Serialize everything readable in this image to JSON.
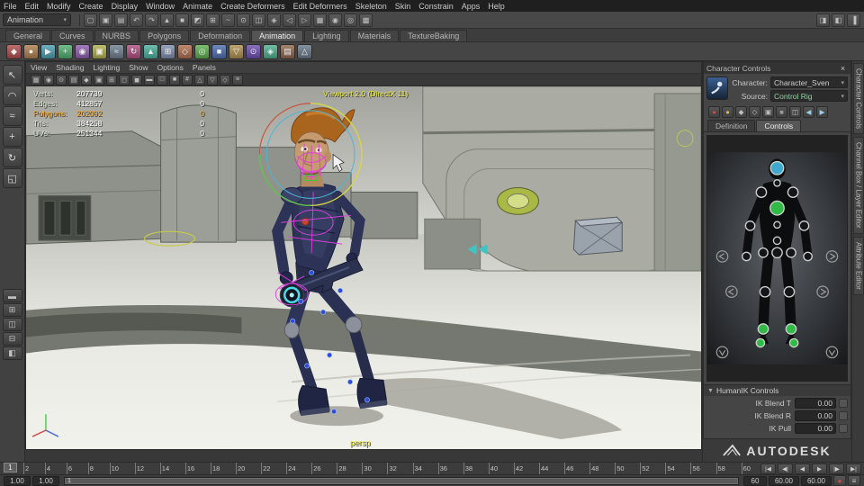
{
  "ui": {
    "caret_down": "▾",
    "tri_down": "▼",
    "close": "×"
  },
  "menubar": {
    "items": [
      "File",
      "Edit",
      "Modify",
      "Create",
      "Display",
      "Window",
      "Animate",
      "Create Deformers",
      "Edit Deformers",
      "Skeleton",
      "Skin",
      "Constrain",
      "Apps",
      "Help"
    ]
  },
  "statusline": {
    "menu_set": "Animation",
    "icons": [
      {
        "name": "new-scene-icon",
        "glyph": "▢"
      },
      {
        "name": "open-scene-icon",
        "glyph": "▣"
      },
      {
        "name": "save-scene-icon",
        "glyph": "▤"
      },
      {
        "name": "undo-icon",
        "glyph": "↶"
      },
      {
        "name": "redo-icon",
        "glyph": "↷"
      },
      {
        "name": "select-hierarchy-icon",
        "glyph": "▲"
      },
      {
        "name": "select-object-icon",
        "glyph": "■"
      },
      {
        "name": "select-component-icon",
        "glyph": "◩"
      },
      {
        "name": "snap-to-grid-icon",
        "glyph": "⊞"
      },
      {
        "name": "snap-to-curve-icon",
        "glyph": "~"
      },
      {
        "name": "snap-to-point-icon",
        "glyph": "⊙"
      },
      {
        "name": "snap-to-plane-icon",
        "glyph": "◫"
      },
      {
        "name": "make-live-icon",
        "glyph": "◈"
      },
      {
        "name": "input-connections-icon",
        "glyph": "◁"
      },
      {
        "name": "output-connections-icon",
        "glyph": "▷"
      },
      {
        "name": "construction-history-icon",
        "glyph": "▦"
      },
      {
        "name": "render-current-frame-icon",
        "glyph": "◉"
      },
      {
        "name": "ipr-render-icon",
        "glyph": "◎"
      },
      {
        "name": "render-settings-icon",
        "glyph": "▩"
      }
    ],
    "right_icons": [
      {
        "name": "attribute-editor-toggle-icon",
        "glyph": "◨"
      },
      {
        "name": "tool-settings-toggle-icon",
        "glyph": "◧"
      },
      {
        "name": "channel-box-toggle-icon",
        "glyph": "▐"
      }
    ]
  },
  "shelf": {
    "active_tab": "Animation",
    "tabs": [
      "General",
      "Curves",
      "NURBS",
      "Polygons",
      "Deformation",
      "Animation",
      "Lighting",
      "Materials",
      "TextureBaking"
    ],
    "icons": [
      {
        "name": "set-key-icon",
        "glyph": "◆",
        "color": "#b05050"
      },
      {
        "name": "set-breakdown-icon",
        "glyph": "●",
        "color": "#b08050"
      },
      {
        "name": "playblast-icon",
        "glyph": "▶",
        "color": "#50a0b0"
      },
      {
        "name": "motion-trail-icon",
        "glyph": "+",
        "color": "#50b070"
      },
      {
        "name": "ghost-icon",
        "glyph": "◉",
        "color": "#9060b0"
      },
      {
        "name": "unghost-icon",
        "glyph": "▣",
        "color": "#b0b050"
      },
      {
        "name": "create-clip-icon",
        "glyph": "≈",
        "color": "#708090"
      },
      {
        "name": "create-pose-icon",
        "glyph": "↻",
        "color": "#b05080"
      },
      {
        "name": "blend-shape-icon",
        "glyph": "▲",
        "color": "#50b0a0"
      },
      {
        "name": "lattice-icon",
        "glyph": "⊞",
        "color": "#8090b0"
      },
      {
        "name": "cluster-icon",
        "glyph": "◇",
        "color": "#b07050"
      },
      {
        "name": "nonlinear-bend-icon",
        "glyph": "◎",
        "color": "#60b050"
      },
      {
        "name": "nonlinear-flare-icon",
        "glyph": "■",
        "color": "#5070b0"
      },
      {
        "name": "nonlinear-sine-icon",
        "glyph": "▽",
        "color": "#b09050"
      },
      {
        "name": "nonlinear-squash-icon",
        "glyph": "⊙",
        "color": "#7050b0"
      },
      {
        "name": "nonlinear-twist-icon",
        "glyph": "◈",
        "color": "#50b090"
      },
      {
        "name": "nonlinear-wave-icon",
        "glyph": "▤",
        "color": "#906a50"
      },
      {
        "name": "jiggle-icon",
        "glyph": "△",
        "color": "#6a7a8a"
      }
    ]
  },
  "toolbox": {
    "tools": [
      {
        "name": "select-tool-icon",
        "glyph": "↖"
      },
      {
        "name": "lasso-tool-icon",
        "glyph": "◠"
      },
      {
        "name": "paint-select-tool-icon",
        "glyph": "≈"
      },
      {
        "name": "move-tool-icon",
        "glyph": "+"
      },
      {
        "name": "rotate-tool-icon",
        "glyph": "↻"
      },
      {
        "name": "scale-tool-icon",
        "glyph": "◱"
      }
    ],
    "layouts": [
      {
        "name": "single-pane-layout-icon",
        "glyph": "▬"
      },
      {
        "name": "four-pane-layout-icon",
        "glyph": "⊞"
      },
      {
        "name": "two-pane-side-layout-icon",
        "glyph": "◫"
      },
      {
        "name": "two-pane-stacked-layout-icon",
        "glyph": "⊟"
      },
      {
        "name": "outliner-persp-layout-icon",
        "glyph": "◧"
      }
    ]
  },
  "viewport": {
    "menu": [
      "View",
      "Shading",
      "Lighting",
      "Show",
      "Options",
      "Panels"
    ],
    "toolbar_icons": [
      {
        "name": "panel-grid-icon",
        "glyph": "▦"
      },
      {
        "name": "camera-select-icon",
        "glyph": "◉"
      },
      {
        "name": "camera-lock-icon",
        "glyph": "⊙"
      },
      {
        "name": "camera-attributes-icon",
        "glyph": "▤"
      },
      {
        "name": "bookmark-icon",
        "glyph": "◆"
      },
      {
        "name": "image-plane-icon",
        "glyph": "▣"
      },
      {
        "name": "two-d-pan-zoom-icon",
        "glyph": "⊞"
      },
      {
        "name": "frame-all-icon",
        "glyph": "◻"
      },
      {
        "name": "frame-selected-icon",
        "glyph": "◼"
      },
      {
        "name": "film-gate-icon",
        "glyph": "▬"
      },
      {
        "name": "resolution-gate-icon",
        "glyph": "□"
      },
      {
        "name": "gate-mask-icon",
        "glyph": "■"
      },
      {
        "name": "field-chart-icon",
        "glyph": "#"
      },
      {
        "name": "safe-action-icon",
        "glyph": "△"
      },
      {
        "name": "safe-title-icon",
        "glyph": "▽"
      },
      {
        "name": "isolate-select-icon",
        "glyph": "◇"
      },
      {
        "name": "grease-pencil-icon",
        "glyph": "≡"
      }
    ],
    "hud": {
      "rows": [
        {
          "label": "Verts:",
          "value": "207739",
          "second": "0"
        },
        {
          "label": "Edges:",
          "value": "412857",
          "second": "0"
        },
        {
          "label": "Polygons:",
          "value": "202092",
          "second": "0",
          "highlight": true
        },
        {
          "label": "Tris:",
          "value": "384258",
          "second": "0"
        },
        {
          "label": "UVs:",
          "value": "251344",
          "second": "0"
        }
      ]
    },
    "renderer_label": "Viewport 2.0 (DirectX 11)",
    "camera_label": "persp"
  },
  "character_controls": {
    "title": "Character Controls",
    "character_label": "Character:",
    "character_value": "Character_Sven",
    "source_label": "Source:",
    "source_value": "Control Rig",
    "icons": [
      {
        "name": "key-full-body-icon",
        "glyph": "●",
        "color": "#c65050"
      },
      {
        "name": "key-body-part-icon",
        "glyph": "●",
        "color": "#d8c040"
      },
      {
        "name": "full-body-mode-icon",
        "glyph": "◆",
        "color": "#c0c0c0"
      },
      {
        "name": "body-part-mode-icon",
        "glyph": "◇",
        "color": "#c0c0c0"
      },
      {
        "name": "selection-mode-icon",
        "glyph": "▣",
        "color": "#c0c0c0"
      },
      {
        "name": "lock-icon",
        "glyph": "■",
        "color": "#9a9a9a"
      },
      {
        "name": "mirror-icon",
        "glyph": "◫",
        "color": "#c0c0c0"
      },
      {
        "name": "prev-key-icon",
        "glyph": "◀",
        "color": "#9ad0e8"
      },
      {
        "name": "next-key-icon",
        "glyph": "▶",
        "color": "#9ad0e8"
      }
    ],
    "tabs": [
      "Definition",
      "Controls"
    ],
    "active_tab": "Controls",
    "humanik_section": "HumanIK Controls",
    "fields": [
      {
        "label": "IK Blend T",
        "value": "0.00"
      },
      {
        "label": "IK Blend R",
        "value": "0.00"
      },
      {
        "label": "IK Pull",
        "value": "0.00"
      }
    ]
  },
  "right_tabs": [
    "Character Controls",
    "Channel Box / Layer Editor",
    "Attribute Editor"
  ],
  "brand": {
    "name": "AUTODESK"
  },
  "timeline": {
    "current": "1",
    "ticks": [
      "2",
      "4",
      "6",
      "8",
      "10",
      "12",
      "14",
      "16",
      "18",
      "20",
      "22",
      "24",
      "26",
      "28",
      "30",
      "32",
      "34",
      "36",
      "38",
      "40",
      "42",
      "44",
      "46",
      "48",
      "50",
      "52",
      "54",
      "56",
      "58",
      "60"
    ],
    "transport": [
      {
        "name": "go-to-start-button",
        "glyph": "|◀"
      },
      {
        "name": "previous-key-button",
        "glyph": "◀|"
      },
      {
        "name": "play-backwards-button",
        "glyph": "◀"
      },
      {
        "name": "play-forwards-button",
        "glyph": "▶"
      },
      {
        "name": "next-key-button",
        "glyph": "|▶"
      },
      {
        "name": "go-to-end-button",
        "glyph": "▶|"
      }
    ]
  },
  "range": {
    "anim_start": "1.00",
    "play_start": "1.00",
    "slider_label": "1",
    "play_end": "60",
    "anim_end": "60.00",
    "alt_end": "60.00",
    "autokey_glyph": "●",
    "prefs_glyph": "≡"
  }
}
